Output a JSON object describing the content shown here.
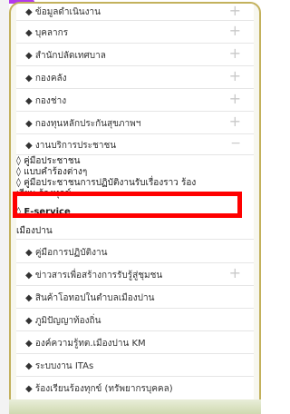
{
  "menu": {
    "items": [
      {
        "label": "◆ ข้อมูลดำเนินงาน",
        "icon": "plus"
      },
      {
        "label": "◆ บุคลากร",
        "icon": "plus"
      },
      {
        "label": "◆ สำนักปลัดเทศบาล",
        "icon": "plus"
      },
      {
        "label": "◆ กองคลัง",
        "icon": "plus"
      },
      {
        "label": "◆ กองช่าง",
        "icon": "plus"
      },
      {
        "label": "◆ กองทุนหลักประกันสุขภาพฯ",
        "icon": "plus"
      },
      {
        "label": "◆ งานบริการประชาชน",
        "icon": "minus"
      }
    ],
    "subitems": [
      {
        "label": "◊ คู่มือประชาชน"
      },
      {
        "label": "◊ แบบคำร้องต่างๆ"
      },
      {
        "label": "◊ คู่มือประชาชนการปฏิบัติงานรับเรื่องราว ร้อง"
      },
      {
        "label": "เรียน ร้องทุกข์"
      },
      {
        "label": "◊ E-service"
      },
      {
        "label": "เมืองปาน"
      }
    ],
    "items2": [
      {
        "label": "◆ คู่มือการปฏิบัติงาน"
      },
      {
        "label": "◆ ข่าวสารเพื่อสร้างการรับรู้สู่ชุมชน",
        "icon": "plus"
      },
      {
        "label": "◆ สินค้าโอทอปในตำบลเมืองปาน"
      },
      {
        "label": "◆ ภูมิปัญญาท้องถิ่น"
      },
      {
        "label": "◆ องค์ความรู้ทต.เมืองปาน KM"
      },
      {
        "label": "◆ ระบบงาน ITAs"
      },
      {
        "label": "◆ ร้องเรียนร้องทุกข์ (ทรัพยากรบุคคล)"
      }
    ]
  }
}
